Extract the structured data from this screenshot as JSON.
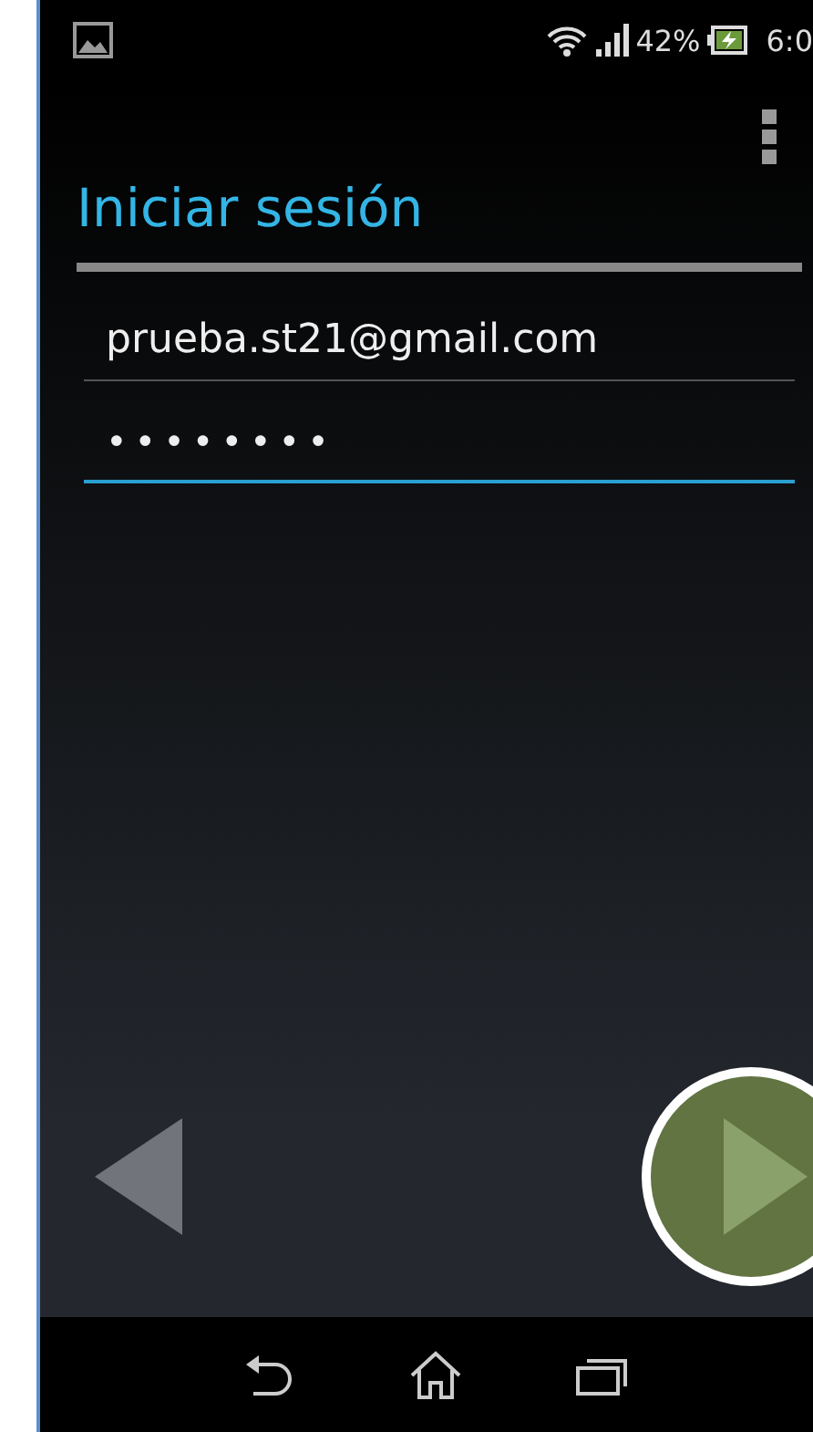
{
  "status_bar": {
    "battery": "42%",
    "time": "6:0"
  },
  "title": "Iniciar sesión",
  "fields": [
    {
      "kind": "email",
      "value": "prueba.st21@gmail.com",
      "focused": false
    },
    {
      "kind": "password",
      "value": "••••••••",
      "focused": true
    }
  ],
  "navigation": {
    "previous_disabled": true
  }
}
